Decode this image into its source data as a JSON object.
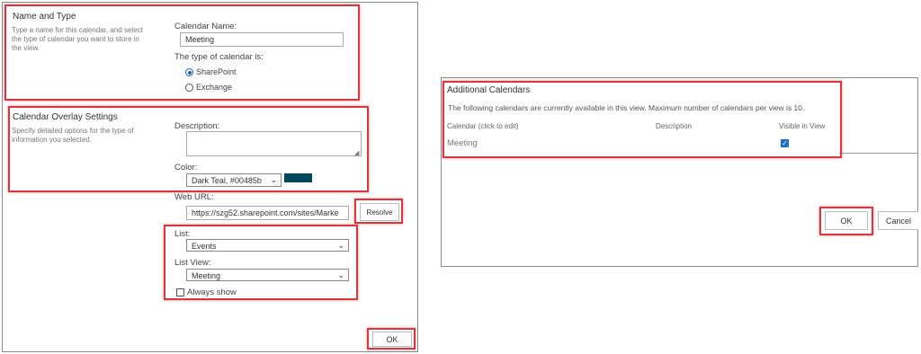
{
  "left": {
    "name_type": {
      "title": "Name and Type",
      "desc_lines": [
        "Type a name for this calendar, and select",
        "the type of calendar you want to store in",
        "the view."
      ],
      "calendar_name_label": "Calendar Name:",
      "calendar_name_value": "Meeting",
      "type_label": "The type of calendar is:",
      "type_options": [
        "SharePoint",
        "Exchange"
      ],
      "type_selected": "SharePoint"
    },
    "overlay": {
      "title": "Calendar Overlay Settings",
      "desc_lines": [
        "Specify detailed options for the type of",
        "information you selected."
      ],
      "description_label": "Description:",
      "description_value": "",
      "color_label": "Color:",
      "color_value": "Dark Teal, #00485b",
      "color_hex": "#00485b",
      "web_url_label": "Web URL:",
      "web_url_value": "https://szg52.sharepoint.com/sites/Marke",
      "resolve_label": "Resolve",
      "list_label": "List:",
      "list_value": "Events",
      "list_view_label": "List View:",
      "list_view_value": "Meeting",
      "always_show_label": "Always show",
      "always_show_checked": false
    },
    "ok_label": "OK"
  },
  "right": {
    "title": "Additional Calendars",
    "info": "The following calendars are currently available in this view. Maximum number of calendars per view is 10.",
    "columns": [
      "Calendar (click to edit)",
      "Description",
      "Visible in View"
    ],
    "rows": [
      {
        "name": "Meeting",
        "description": "",
        "visible": true
      }
    ],
    "ok_label": "OK",
    "cancel_label": "Cancel"
  },
  "colors": {
    "highlight": "#d9363e",
    "accent": "#1a5fb4"
  }
}
